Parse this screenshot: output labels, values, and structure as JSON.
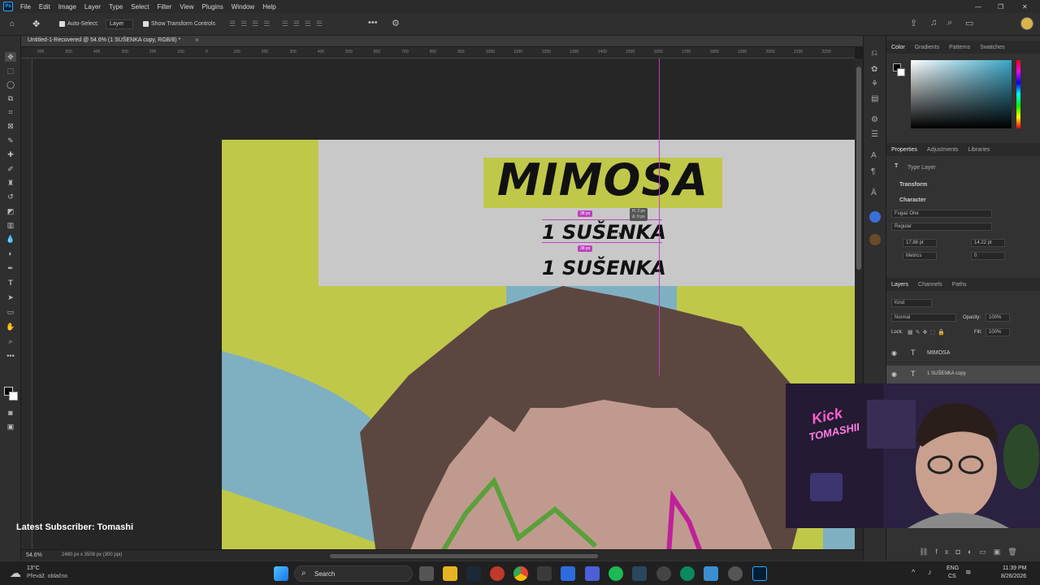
{
  "app": {
    "logo": "Ps"
  },
  "menu": [
    "File",
    "Edit",
    "Image",
    "Layer",
    "Type",
    "Select",
    "Filter",
    "View",
    "Plugins",
    "Window",
    "Help"
  ],
  "options": {
    "auto_select": "Auto-Select:",
    "layer_select": "Layer",
    "show_transform": "Show Transform Controls"
  },
  "document_tab": {
    "title": "Untitled-1-Recovered @ 54.6% (1 SUŠENKA copy, RGB/8) *",
    "close": "×"
  },
  "ruler_top": [
    "600",
    "500",
    "400",
    "300",
    "200",
    "100",
    "0",
    "100",
    "200",
    "300",
    "400",
    "500",
    "600",
    "700",
    "800",
    "900",
    "1000",
    "1100",
    "1200",
    "1300",
    "1400",
    "1500",
    "1600",
    "1700",
    "1800",
    "1900",
    "2000",
    "2100",
    "2200"
  ],
  "canvas": {
    "title": "MIMOSA",
    "line1": "1 SUŠENKA",
    "line2": "1 SUŠENKA",
    "measure_top": "38 px",
    "measure_bottom": "38 px",
    "tooltip_x": "H: 2 px",
    "tooltip_y": "Δ: 0 px"
  },
  "status": {
    "zoom": "54.6%",
    "doc_size": "2480 px x 3508 px (300 ppi)"
  },
  "panels": {
    "color_tabs": [
      "Color",
      "Gradients",
      "Patterns",
      "Swatches"
    ],
    "prop_tabs": [
      "Properties",
      "Adjustments",
      "Libraries"
    ],
    "type_layer": "Type Layer",
    "transform": "Transform",
    "character": "Character",
    "font_family": "Fugaz One",
    "font_style": "Regular",
    "font_size": "17.88 pt",
    "leading": "14.22 pt",
    "kerning": "Metrics",
    "tracking": "0",
    "layer_tabs": [
      "Layers",
      "Channels",
      "Paths"
    ],
    "filter_kind": "Kind",
    "blend_mode": "Normal",
    "opacity_label": "Opacity:",
    "opacity": "100%",
    "lock_label": "Lock:",
    "fill_label": "Fill:",
    "fill": "100%",
    "layers": [
      {
        "name": "MIMOSA",
        "type": "T"
      },
      {
        "name": "1 SUŠENKA copy",
        "type": "T"
      }
    ]
  },
  "overlay": {
    "subscriber": "Latest Subscriber: Tomashi",
    "neon_line1": "Kick",
    "neon_line2": "TOMASHII"
  },
  "taskbar": {
    "weather_temp": "13°C",
    "weather_desc": "Převáž. oblačno",
    "search": "Search",
    "lang1": "ENG",
    "lang2": "CS",
    "time": "11:39 PM",
    "date": "8/26/2026"
  },
  "colors": {
    "accent_green": "#c0c84a",
    "banner_gray": "#c8c8c8",
    "hair_brown": "#5c4640",
    "sky_blue": "#7fb0c2",
    "guide_magenta": "#c040c0",
    "ps_blue": "#31a8ff"
  }
}
